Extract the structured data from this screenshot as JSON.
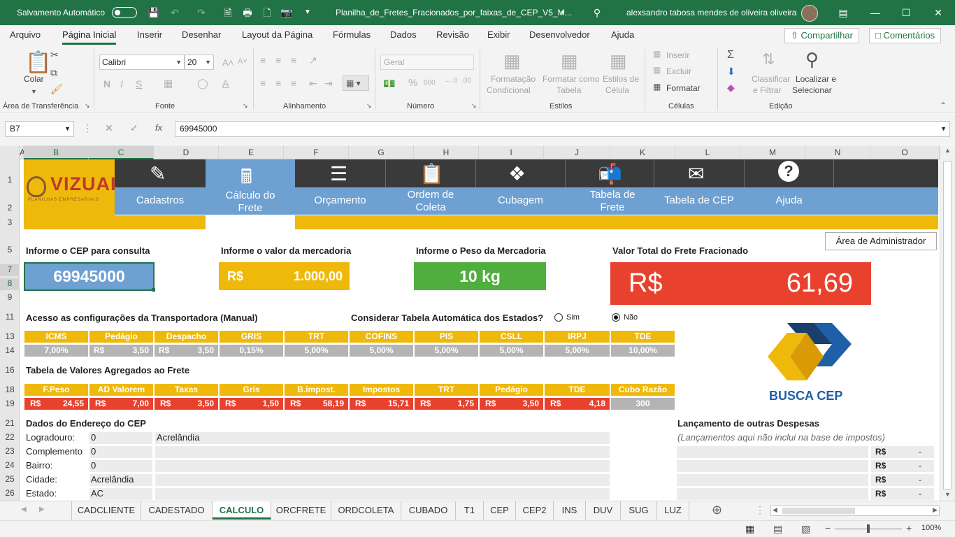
{
  "titlebar": {
    "autosave_label": "Salvamento Automático",
    "file_name": "Planilha_de_Fretes_Fracionados_por_faixas_de_CEP_V5_M...",
    "user_name": "alexsandro tabosa mendes de oliveira oliveira"
  },
  "menu": {
    "items": [
      "Arquivo",
      "Página Inicial",
      "Inserir",
      "Desenhar",
      "Layout da Página",
      "Fórmulas",
      "Dados",
      "Revisão",
      "Exibir",
      "Desenvolvedor",
      "Ajuda"
    ],
    "share": "Compartilhar",
    "comments": "Comentários"
  },
  "ribbon": {
    "clipboard": {
      "paste": "Colar",
      "group": "Área de Transferência"
    },
    "font": {
      "name": "Calibri",
      "size": "20",
      "bold": "N",
      "italic": "I",
      "underline": "S",
      "group": "Fonte"
    },
    "alignment": {
      "group": "Alinhamento"
    },
    "number": {
      "format": "Geral",
      "group": "Número"
    },
    "styles": {
      "conditional": [
        "Formatação",
        "Condicional"
      ],
      "as_table": [
        "Formatar como",
        "Tabela"
      ],
      "cell_styles": [
        "Estilos de",
        "Célula"
      ],
      "group": "Estilos"
    },
    "cells": {
      "insert": "Inserir",
      "delete": "Excluir",
      "format": "Formatar",
      "group": "Células"
    },
    "editing": {
      "sort": [
        "Classificar",
        "e Filtrar"
      ],
      "find": [
        "Localizar e",
        "Selecionar"
      ],
      "group": "Edição"
    }
  },
  "formula_bar": {
    "name_box": "B7",
    "fx": "fx",
    "value": "69945000"
  },
  "columns": [
    "A",
    "B",
    "C",
    "D",
    "E",
    "F",
    "G",
    "H",
    "I",
    "J",
    "K",
    "L",
    "M",
    "N",
    "O"
  ],
  "rows": [
    "1",
    "2",
    "3",
    "5",
    "7",
    "8",
    "9",
    "11",
    "13",
    "14",
    "16",
    "18",
    "19",
    "21",
    "22",
    "23",
    "24",
    "25",
    "26"
  ],
  "logo": {
    "text": "VIZUAL",
    "sub": "PLANILHAS EMPRESARIAIS"
  },
  "nav": [
    "Cadastros",
    "Cálculo do Frete",
    "Orçamento",
    "Ordem de Coleta",
    "Cubagem",
    "Tabela de Frete",
    "Tabela de CEP",
    "Ajuda"
  ],
  "query": {
    "cep_label": "Informe o CEP para consulta",
    "cep_value": "69945000",
    "merch_label": "Informe o valor da mercadoria",
    "merch_currency": "R$",
    "merch_value": "1.000,00",
    "weight_label": "Informe o Peso da Mercadoria",
    "weight_value": "10 kg",
    "total_label": "Valor Total do Frete Fracionado",
    "total_currency": "R$",
    "total_value": "61,69",
    "admin_button": "Área de Administrador"
  },
  "carrier": {
    "label": "Acesso as configurações da Transportadora (Manual)",
    "auto_question": "Considerar Tabela Automática dos Estados?",
    "yes": "Sim",
    "no": "Não",
    "headers": [
      "ICMS",
      "Pedágio",
      "Despacho",
      "GRIS",
      "TRT",
      "COFINS",
      "PIS",
      "CSLL",
      "IRPJ",
      "TDE"
    ],
    "values": [
      {
        "cur": "",
        "v": "7,00%"
      },
      {
        "cur": "R$",
        "v": "3,50"
      },
      {
        "cur": "R$",
        "v": "3,50"
      },
      {
        "cur": "",
        "v": "0,15%"
      },
      {
        "cur": "",
        "v": "5,00%"
      },
      {
        "cur": "",
        "v": "5,00%"
      },
      {
        "cur": "",
        "v": "5,00%"
      },
      {
        "cur": "",
        "v": "5,00%"
      },
      {
        "cur": "",
        "v": "5,00%"
      },
      {
        "cur": "",
        "v": "10,00%"
      }
    ]
  },
  "aggregated": {
    "label": "Tabela de Valores Agregados ao Frete",
    "headers": [
      "F.Peso",
      "AD Valorem",
      "Taxas",
      "Gris",
      "B.impost.",
      "Impostos",
      "TRT",
      "Pedágio",
      "TDE",
      "Cubo Razão"
    ],
    "values": [
      {
        "cur": "R$",
        "v": "24,55"
      },
      {
        "cur": "R$",
        "v": "7,00"
      },
      {
        "cur": "R$",
        "v": "3,50"
      },
      {
        "cur": "R$",
        "v": "1,50"
      },
      {
        "cur": "R$",
        "v": "58,19"
      },
      {
        "cur": "R$",
        "v": "15,71"
      },
      {
        "cur": "R$",
        "v": "1,75"
      },
      {
        "cur": "R$",
        "v": "3,50"
      },
      {
        "cur": "R$",
        "v": "4,18"
      },
      {
        "cur": "",
        "v": "300"
      }
    ]
  },
  "address": {
    "label": "Dados do Endereço do CEP",
    "rows": [
      {
        "k": "Logradouro:",
        "v": "0",
        "extra": "Acrelândia"
      },
      {
        "k": "Complemento",
        "v": "0",
        "extra": ""
      },
      {
        "k": "Bairro:",
        "v": "0",
        "extra": ""
      },
      {
        "k": "Cidade:",
        "v": "Acrelândia",
        "extra": ""
      },
      {
        "k": "Estado:",
        "v": "AC",
        "extra": ""
      }
    ]
  },
  "other_expenses": {
    "label": "Lançamento de outras Despesas",
    "note": "(Lançamentos aqui não inclui na base de impostos)",
    "rows": [
      {
        "cur": "R$",
        "v": "-"
      },
      {
        "cur": "R$",
        "v": "-"
      },
      {
        "cur": "R$",
        "v": "-"
      },
      {
        "cur": "R$",
        "v": "-"
      }
    ]
  },
  "busca_cep": {
    "text": "BUSCA CEP"
  },
  "tabs": [
    "CADCLIENTE",
    "CADESTADO",
    "CALCULO",
    "ORCFRETE",
    "ORDCOLETA",
    "CUBADO",
    "T1",
    "CEP",
    "CEP2",
    "INS",
    "DUV",
    "SUG",
    "LUZ"
  ],
  "status": {
    "zoom": "100%"
  },
  "colors": {
    "excel_green": "#217346",
    "nav_dark": "#3a3a3a",
    "nav_blue": "#6ea0d2",
    "yellow": "#efb90b",
    "red": "#e8422e",
    "green": "#4fae3d",
    "grey": "#b4b4b4"
  }
}
